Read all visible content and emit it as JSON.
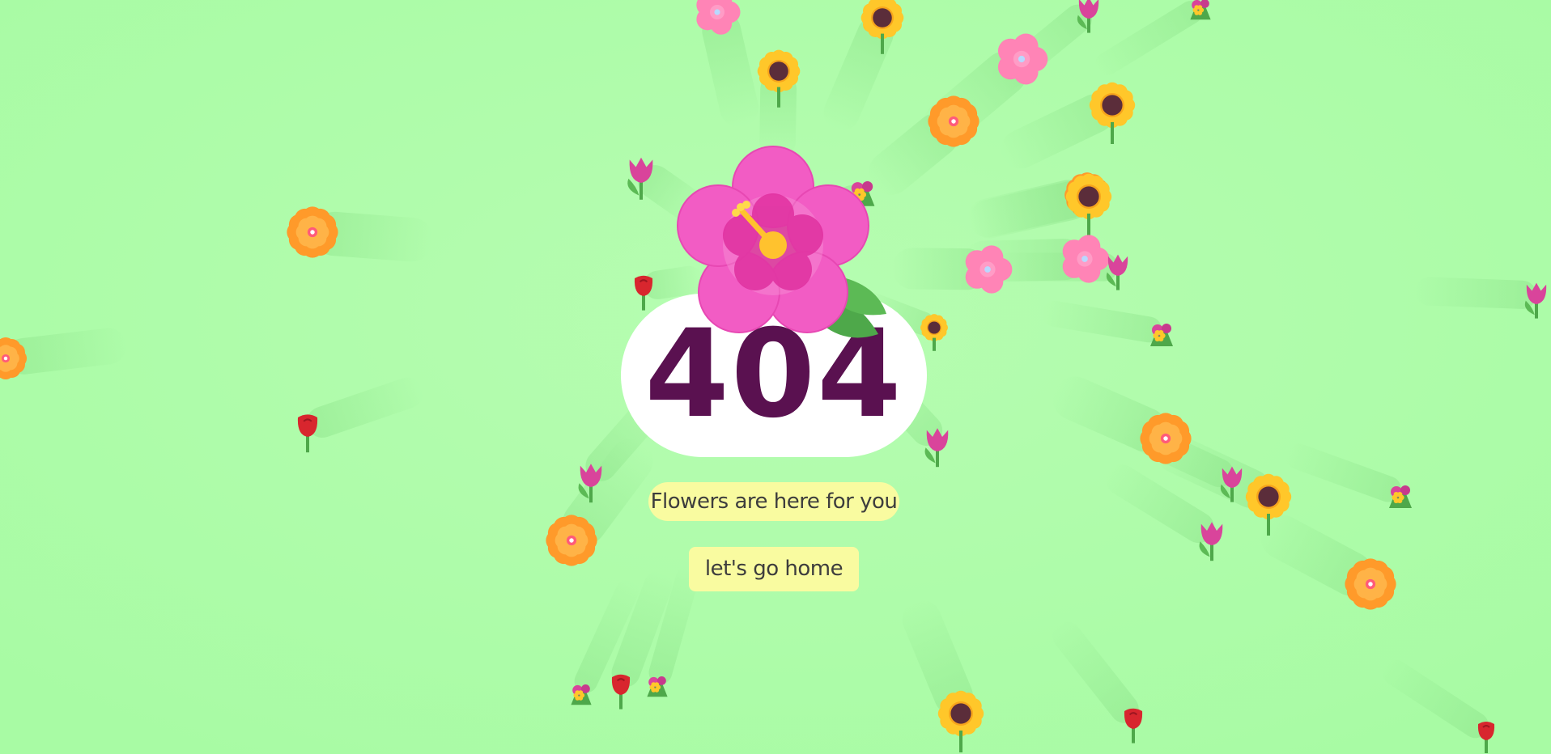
{
  "error": {
    "code": "404"
  },
  "tagline": "Flowers are here for you",
  "home_button": {
    "label": "let's go home"
  },
  "colors": {
    "background": "#adfca9",
    "code_text": "#5a1150",
    "pill": "#f9fba0",
    "card": "#ffffff",
    "hibiscus": "#f25cc4",
    "marigold": "#ff9a2a",
    "sunflower": "#ffc72a",
    "tulip_pink": "#d9449b",
    "tulip_red": "#d8262e",
    "cherry_blossom": "#ff84b6"
  },
  "flowers": [
    {
      "kind": "cherry-blossom-icon"
    },
    {
      "kind": "sunflower-icon"
    },
    {
      "kind": "sunflower-icon"
    },
    {
      "kind": "tulip-icon"
    },
    {
      "kind": "bouquet-icon"
    },
    {
      "kind": "cherry-blossom-icon"
    },
    {
      "kind": "sunflower-icon"
    },
    {
      "kind": "marigold-icon"
    },
    {
      "kind": "tulip-icon"
    },
    {
      "kind": "bouquet-icon"
    },
    {
      "kind": "marigold-icon"
    },
    {
      "kind": "sunflower-icon"
    },
    {
      "kind": "cherry-blossom-icon"
    },
    {
      "kind": "cherry-blossom-icon"
    },
    {
      "kind": "tulip-icon"
    },
    {
      "kind": "rose-icon"
    },
    {
      "kind": "bouquet-icon"
    },
    {
      "kind": "marigold-icon"
    },
    {
      "kind": "rose-icon"
    },
    {
      "kind": "tulip-icon"
    },
    {
      "kind": "tulip-icon"
    },
    {
      "kind": "marigold-icon"
    },
    {
      "kind": "marigold-icon"
    },
    {
      "kind": "tulip-icon"
    },
    {
      "kind": "sunflower-icon"
    },
    {
      "kind": "tulip-icon"
    },
    {
      "kind": "bouquet-icon"
    },
    {
      "kind": "marigold-icon"
    },
    {
      "kind": "tulip-icon"
    },
    {
      "kind": "bouquet-icon"
    },
    {
      "kind": "rose-icon"
    },
    {
      "kind": "bouquet-icon"
    },
    {
      "kind": "sunflower-icon"
    },
    {
      "kind": "rose-icon"
    },
    {
      "kind": "rose-icon"
    },
    {
      "kind": "marigold-icon"
    },
    {
      "kind": "sunflower-icon"
    },
    {
      "kind": "marigold-icon"
    }
  ]
}
